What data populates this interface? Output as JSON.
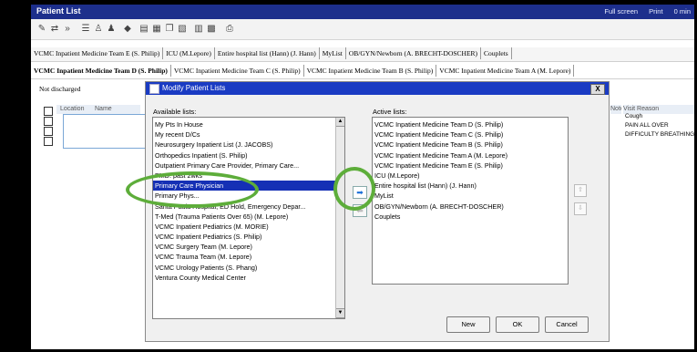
{
  "window": {
    "title": "Patient List",
    "tools": [
      "Full screen",
      "Print",
      "0 min"
    ]
  },
  "tabs_row1": [
    "VCMC Inpatient Medicine Team E  (S. Philip)",
    "ICU (M.Lepore)",
    "Entire hospital list (Hann)  (J. Hann)",
    "MyList",
    "OB/GYN/Newborn  (A. BRECHT-DOSCHER)",
    "Couplets"
  ],
  "tabs_row2": [
    "VCMC Inpatient Medicine Team D  (S. Philip)",
    "VCMC Inpatient Medicine Team C  (S. Philip)",
    "VCMC Inpatient Medicine Team B  (S. Philip)",
    "VCMC Inpatient Medicine Team A  (M. Lepore)"
  ],
  "filter_label": "Not discharged",
  "grid": {
    "col_location": "Location",
    "col_name": "Name",
    "col_note": "Note",
    "col_visit_reason": "Visit Reason",
    "visit_reasons": [
      "Cough",
      "PAIN ALL OVER",
      "DIFFICULTY BREATHING"
    ]
  },
  "dialog": {
    "title": "Modify Patient Lists",
    "close": "X",
    "available_label": "Available lists:",
    "active_label": "Active lists:",
    "available": [
      "My Pts In House",
      "My recent D/Cs",
      "Neurosurgery Inpatient List  (J. JACOBS)",
      "Orthopedics Inpatient  (S. Philip)",
      "Outpatient Primary Care Provider, Primary Care...",
      "PMD: past 2wks",
      "Primary Care Physician",
      "Primary Phys...",
      "Santa Paula Hospital, ED Hold, Emergency Depar...",
      "T-Med (Trauma Patients Over 65)  (M. Lepore)",
      "VCMC Inpatient Pediatrics  (M. MORIE)",
      "VCMC Inpatient Pediatrics  (S. Philip)",
      "VCMC Surgery Team  (M. Lepore)",
      "VCMC Trauma Team  (M. Lepore)",
      "VCMC Urology Patients  (S. Phang)",
      "Ventura County Medical Center"
    ],
    "selected_available": "Primary Care Physician",
    "active": [
      "VCMC Inpatient Medicine Team D  (S. Philip)",
      "VCMC Inpatient Medicine Team C  (S. Philip)",
      "VCMC Inpatient Medicine Team B  (S. Philip)",
      "VCMC Inpatient Medicine Team A  (M. Lepore)",
      "VCMC Inpatient Medicine Team E  (S. Philip)",
      "ICU (M.Lepore)",
      "Entire hospital list (Hann)  (J. Hann)",
      "MyList",
      "OB/GYN/Newborn  (A. BRECHT-DOSCHER)",
      "Couplets"
    ],
    "buttons": {
      "new": "New",
      "ok": "OK",
      "cancel": "Cancel"
    }
  },
  "colors": {
    "titlebar": "#1d2f8c",
    "dialog_title": "#1a3bc3",
    "selection": "#1530b5",
    "annotation_ring": "#5dad3a"
  }
}
